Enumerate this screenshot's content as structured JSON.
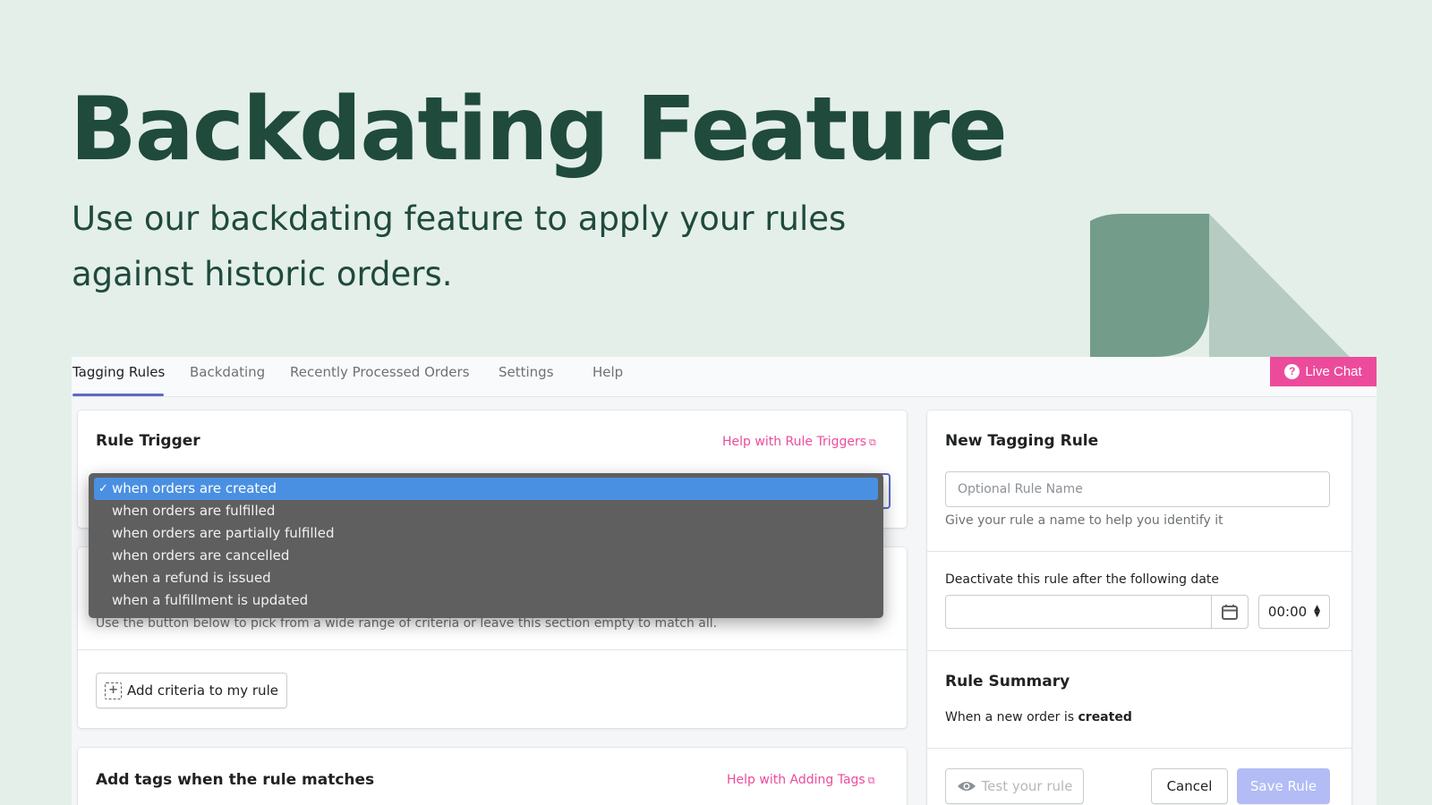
{
  "hero": {
    "title": "Backdating Feature",
    "subtitle": "Use our backdating feature to apply your rules against historic orders."
  },
  "colors": {
    "background": "#e4efea",
    "heading": "#1f4a3c",
    "accent_pink": "#ec4b9c",
    "tab_indicator": "#5c6ac4",
    "dropdown_selected": "#4a90e2"
  },
  "tabs": [
    {
      "label": "Tagging Rules",
      "active": true
    },
    {
      "label": "Backdating"
    },
    {
      "label": "Recently Processed Orders"
    },
    {
      "label": "Settings"
    },
    {
      "label": "Help"
    }
  ],
  "live_chat": {
    "label": "Live Chat",
    "icon": "question-circle-icon"
  },
  "rule_trigger": {
    "title": "Rule Trigger",
    "help_link": "Help with Rule Triggers",
    "options": [
      "when orders are created",
      "when orders are fulfilled",
      "when orders are partially fulfilled",
      "when orders are cancelled",
      "when a refund is issued",
      "when a fulfillment is updated"
    ],
    "selected": "when orders are created"
  },
  "criteria": {
    "description": "Use the button below to pick from a wide range of criteria or leave this section empty to match all.",
    "add_button": "Add criteria to my rule"
  },
  "add_tags": {
    "title": "Add tags when the rule matches",
    "help_link": "Help with Adding Tags"
  },
  "new_rule": {
    "title": "New Tagging Rule",
    "name_placeholder": "Optional Rule Name",
    "name_hint": "Give your rule a name to help you identify it",
    "deactivate_label": "Deactivate this rule after the following date",
    "time_value": "00:00",
    "summary_title": "Rule Summary",
    "summary_prefix": "When a new order is ",
    "summary_bold": "created",
    "test_button": "Test your rule",
    "cancel_button": "Cancel",
    "save_button": "Save Rule"
  }
}
